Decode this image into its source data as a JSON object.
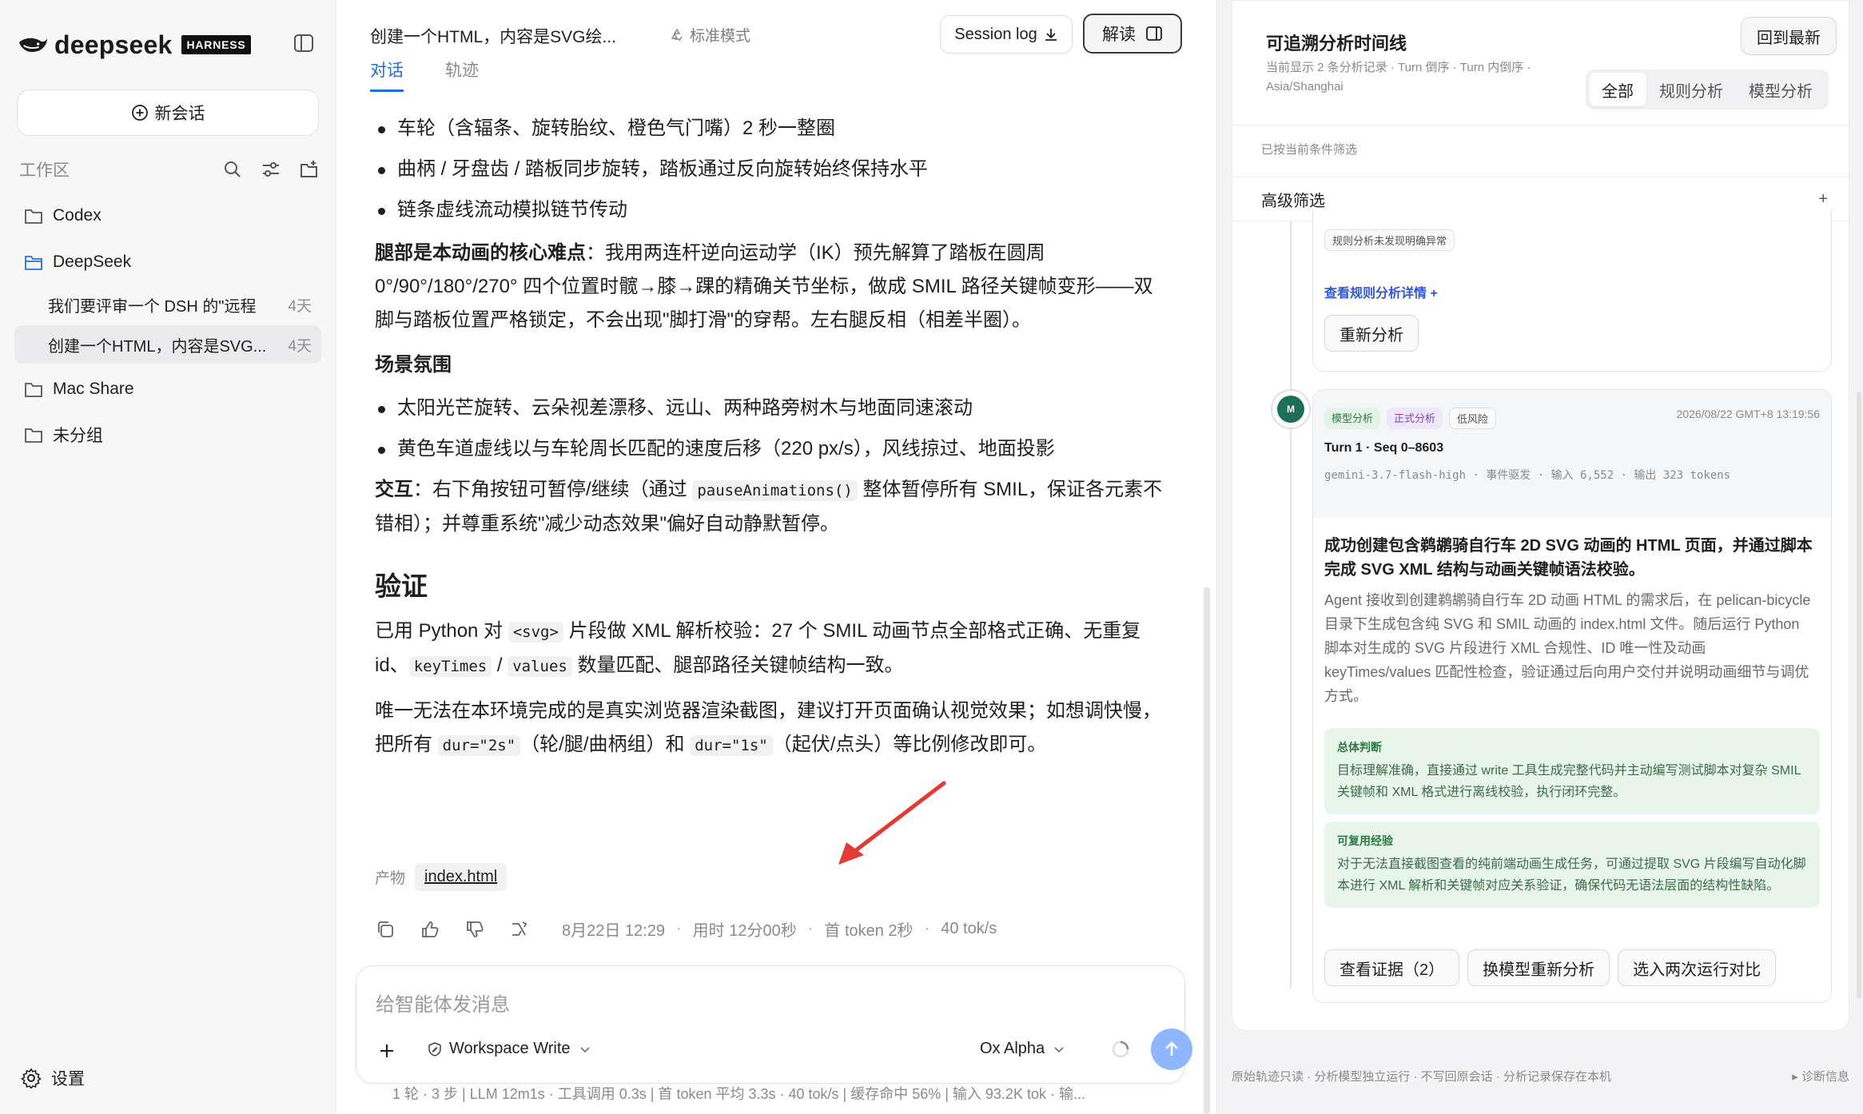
{
  "sidebar": {
    "logo_text": "deepseek",
    "logo_badge": "HARNESS",
    "new_chat": "新会话",
    "workspace_label": "工作区",
    "folders": {
      "codex": "Codex",
      "deepseek": "DeepSeek",
      "mac_share": "Mac Share",
      "ungrouped": "未分组"
    },
    "conversations": [
      {
        "title": "我们要评审一个 DSH 的\"远程",
        "time": "4天"
      },
      {
        "title": "创建一个HTML，内容是SVG...",
        "time": "4天"
      }
    ],
    "settings": "设置"
  },
  "main": {
    "title": "创建一个HTML，内容是SVG绘...",
    "mode": "标准模式",
    "session_log": "Session log",
    "jiedu": "解读",
    "tabs": [
      "对话",
      "轨迹"
    ],
    "bullets_top": [
      "车轮（含辐条、旋转胎纹、橙色气门嘴）2 秒一整圈",
      "曲柄 / 牙盘齿 / 踏板同步旋转，踏板通过反向旋转始终保持水平",
      "链条虚线流动模拟链节传动"
    ],
    "legs_bold": "腿部是本动画的核心难点",
    "legs_text": "：我用两连杆逆向运动学（IK）预先解算了踏板在圆周 0°/90°/180°/270° 四个位置时髋→膝→踝的精确关节坐标，做成 SMIL 路径关键帧变形——双脚与踏板位置严格锁定，不会出现\"脚打滑\"的穿帮。左右腿反相（相差半圈）。",
    "scene_title": "场景氛围",
    "bullets_scene": [
      "太阳光芒旋转、云朵视差漂移、远山、两种路旁树木与地面同速滚动",
      "黄色车道虚线以与车轮周长匹配的速度后移（220 px/s），风线掠过、地面投影"
    ],
    "interact_bold": "交互",
    "interact_a": "：右下角按钮可暂停/继续（通过 ",
    "interact_code": "pauseAnimations()",
    "interact_b": " 整体暂停所有 SMIL，保证各元素不错相）；并尊重系统\"减少动态效果\"偏好自动静默暂停。",
    "verify_title": "验证",
    "verify_a": "已用 Python 对 ",
    "verify_code1": "<svg>",
    "verify_b": " 片段做 XML 解析校验：27 个 SMIL 动画节点全部格式正确、无重复 id、",
    "verify_code2": "keyTimes",
    "verify_slash": " / ",
    "verify_code3": "values",
    "verify_c": " 数量匹配、腿部路径关键帧结构一致。",
    "note_a": "唯一无法在本环境完成的是真实浏览器渲染截图，建议打开页面确认视觉效果；如想调快慢，把所有 ",
    "note_code1": "dur=\"2s\"",
    "note_b": "（轮/腿/曲柄组）和 ",
    "note_code2": "dur=\"1s\"",
    "note_c": "（起伏/点头）等比例修改即可。",
    "artifact_label": "产物",
    "artifact_file": "index.html",
    "meta": {
      "date": "8月22日 12:29",
      "duration": "用时 12分00秒",
      "first_token": "首 token 2秒",
      "speed": "40 tok/s"
    },
    "composer": {
      "placeholder": "给智能体发消息",
      "workspace": "Workspace Write",
      "model": "Ox Alpha"
    },
    "stats": "1 轮 · 3 步  |  LLM 12m1s · 工具调用 0.3s  |  首 token 平均 3.3s · 40 tok/s  |  缓存命中 56%  |  输入 93.2K tok · 输..."
  },
  "right": {
    "title": "可追溯分析时间线",
    "subtitle": "当前显示 2 条分析记录 · Turn 倒序 · Turn 内倒序 · Asia/Shanghai",
    "latest": "回到最新",
    "segments": [
      "全部",
      "规则分析",
      "模型分析"
    ],
    "filtered": "已按当前条件筛选",
    "advanced": "高级筛选",
    "card1": {
      "pill": "规则分析未发现明确异常",
      "link": "查看规则分析详情 +",
      "button": "重新分析"
    },
    "avatar": "M",
    "card2": {
      "tags": [
        "模型分析",
        "正式分析",
        "低风险"
      ],
      "timestamp": "2026/08/22 GMT+8 13:19:56",
      "turn": "Turn 1 · Seq 0–8603",
      "model_line": "gemini-3.7-flash-high · 事件驱发 · 输入 6,552 · 输出 323 tokens",
      "title": "成功创建包含鹈鹕骑自行车 2D SVG 动画的 HTML 页面，并通过脚本完成 SVG XML 结构与动画关键帧语法校验。",
      "desc": "Agent 接收到创建鹈鹕骑自行车 2D 动画 HTML 的需求后，在 pelican-bicycle 目录下生成包含纯 SVG 和 SMIL 动画的 index.html 文件。随后运行 Python 脚本对生成的 SVG 片段进行 XML 合规性、ID 唯一性及动画 keyTimes/values 匹配性检查，验证通过后向用户交付并说明动画细节与调优方式。",
      "judge_title": "总体判断",
      "judge_body": "目标理解准确，直接通过 write 工具生成完整代码并主动编写测试脚本对复杂 SMIL 关键帧和 XML 格式进行离线校验，执行闭环完整。",
      "exp_title": "可复用经验",
      "exp_body": "对于无法直接截图查看的纯前端动画生成任务，可通过提取 SVG 片段编写自动化脚本进行 XML 解析和关键帧对应关系验证，确保代码无语法层面的结构性缺陷。",
      "buttons": [
        "查看证据（2）",
        "换模型重新分析",
        "选入两次运行对比"
      ]
    },
    "footer_left": "原始轨迹只读 · 分析模型独立运行 · 不写回原会话 · 分析记录保存在本机",
    "footer_right": "▸ 诊断信息"
  }
}
